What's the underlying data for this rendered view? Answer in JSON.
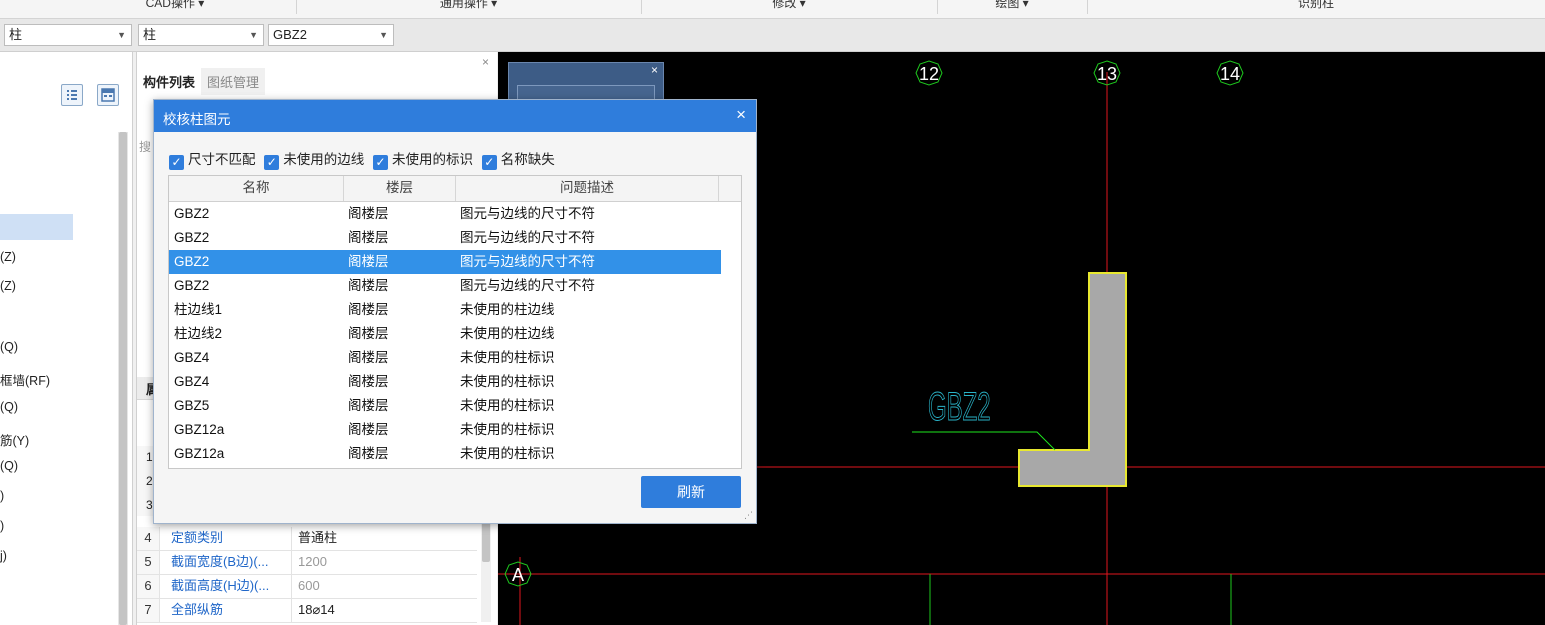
{
  "ribbon": {
    "groups": [
      "CAD操作 ▾",
      "通用操作 ▾",
      "修改 ▾",
      "绘图 ▾",
      "识别柱"
    ]
  },
  "toolbar": {
    "combo1": "柱",
    "combo2": "柱",
    "combo3": "GBZ2"
  },
  "tree": {
    "items": [
      "(Z)",
      "(Z)",
      "(Q)",
      "框墙(RF)",
      "(Q)",
      "筋(Y)",
      "(Q)",
      ")",
      ")",
      "j)"
    ]
  },
  "mid_panel": {
    "close_glyph": "×",
    "tabs": [
      "构件列表",
      "图纸管理"
    ],
    "search_fragment": "搜",
    "hidden_labels": [
      "属",
      "1",
      "2",
      "3"
    ],
    "properties": [
      {
        "num": "4",
        "name": "定额类别",
        "value": "普通柱"
      },
      {
        "num": "5",
        "name": "截面宽度(B边)(...",
        "value": "1200"
      },
      {
        "num": "6",
        "name": "截面高度(H边)(...",
        "value": "600"
      },
      {
        "num": "7",
        "name": "全部纵筋",
        "value": "18⌀14"
      }
    ]
  },
  "canvas": {
    "axis_labels": {
      "c12": "12",
      "c13": "13",
      "c14": "14",
      "rowA": "A"
    },
    "column_label": "GBZ2",
    "colors": {
      "axis": "#e0161e",
      "column_fill": "#a8a8a8",
      "column_edge": "#e8e830",
      "label": "#2ab4c9",
      "leader": "#1ee61e",
      "circle": "#1ec81e"
    }
  },
  "mini_panel": {
    "close_glyph": "×"
  },
  "dialog": {
    "title": "校核柱图元",
    "close_glyph": "×",
    "checks": [
      {
        "label": "尺寸不匹配",
        "checked": true
      },
      {
        "label": "未使用的边线",
        "checked": true
      },
      {
        "label": "未使用的标识",
        "checked": true
      },
      {
        "label": "名称缺失",
        "checked": true
      }
    ],
    "check_glyph": "✓",
    "columns": [
      "名称",
      "楼层",
      "问题描述"
    ],
    "rows": [
      {
        "name": "GBZ2",
        "floor": "阁楼层",
        "desc": "图元与边线的尺寸不符"
      },
      {
        "name": "GBZ2",
        "floor": "阁楼层",
        "desc": "图元与边线的尺寸不符"
      },
      {
        "name": "GBZ2",
        "floor": "阁楼层",
        "desc": "图元与边线的尺寸不符",
        "selected": true
      },
      {
        "name": "GBZ2",
        "floor": "阁楼层",
        "desc": "图元与边线的尺寸不符"
      },
      {
        "name": "柱边线1",
        "floor": "阁楼层",
        "desc": "未使用的柱边线"
      },
      {
        "name": "柱边线2",
        "floor": "阁楼层",
        "desc": "未使用的柱边线"
      },
      {
        "name": "GBZ4",
        "floor": "阁楼层",
        "desc": "未使用的柱标识"
      },
      {
        "name": "GBZ4",
        "floor": "阁楼层",
        "desc": "未使用的柱标识"
      },
      {
        "name": "GBZ5",
        "floor": "阁楼层",
        "desc": "未使用的柱标识"
      },
      {
        "name": "GBZ12a",
        "floor": "阁楼层",
        "desc": "未使用的柱标识"
      },
      {
        "name": "GBZ12a",
        "floor": "阁楼层",
        "desc": "未使用的柱标识"
      }
    ],
    "refresh_label": "刷新"
  }
}
